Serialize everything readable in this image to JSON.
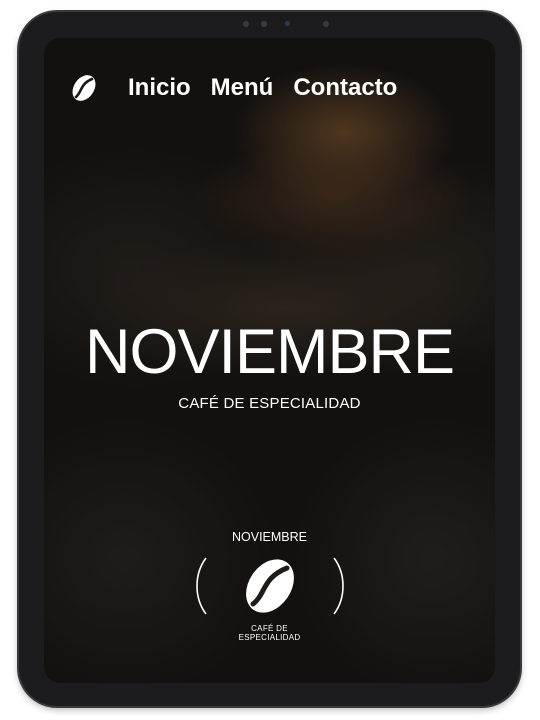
{
  "nav": {
    "links": [
      "Inicio",
      "Menú",
      "Contacto"
    ]
  },
  "hero": {
    "title": "NOVIEMBRE",
    "subtitle": "CAFÉ DE ESPECIALIDAD"
  },
  "badge": {
    "top": "NOVIEMBRE",
    "bottom_line1": "CAFÉ DE",
    "bottom_line2": "ESPECIALIDAD"
  },
  "colors": {
    "device": "#1c1c1e",
    "text": "#ffffff"
  },
  "icons": {
    "logo": "coffee-bean-icon",
    "badge": "coffee-bean-icon"
  }
}
